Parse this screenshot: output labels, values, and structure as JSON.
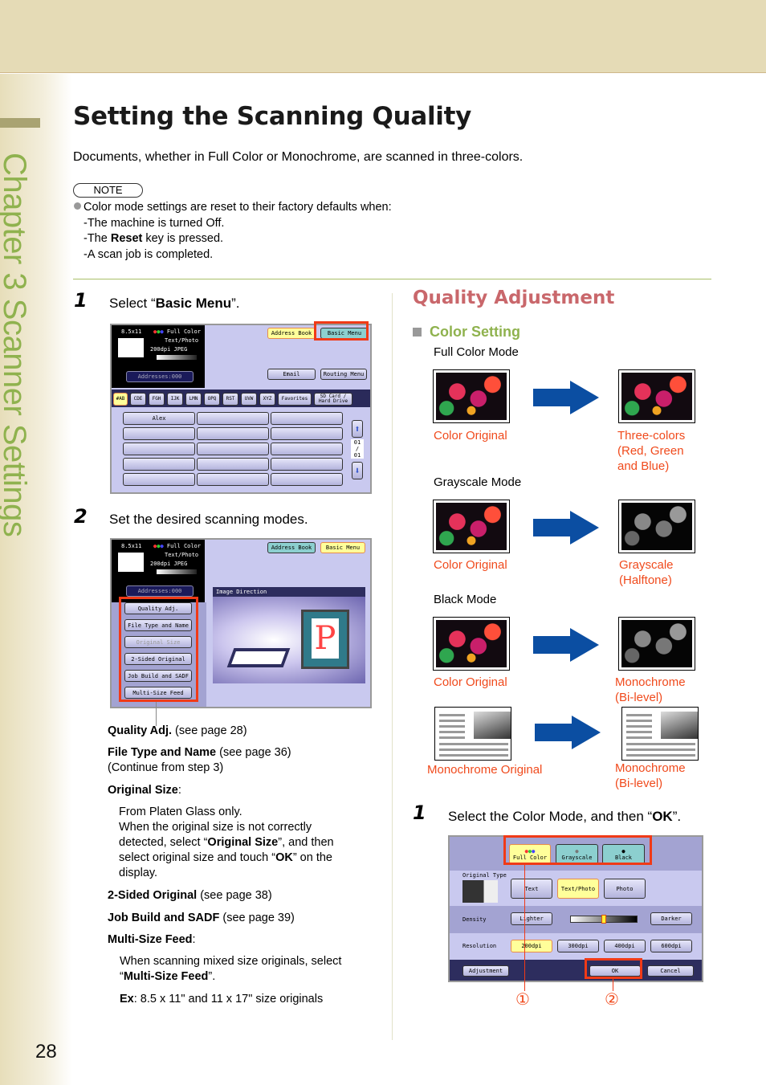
{
  "chapter_label": "Chapter 3   Scanner Settings",
  "page_number": "28",
  "title": "Setting the Scanning Quality",
  "intro": "Documents, whether in Full Color or Monochrome, are scanned in three-colors.",
  "note": {
    "label": "NOTE",
    "lead": "Color mode settings are reset to their factory defaults when:",
    "items": [
      "-The machine is turned Off.",
      "-The ",
      "Reset",
      " key is pressed.",
      "-A scan job is completed."
    ]
  },
  "steps_left": [
    {
      "num": "1",
      "pre": "Select “",
      "bold": "Basic Menu",
      "post": "”."
    },
    {
      "num": "2",
      "text": "Set the desired scanning modes."
    }
  ],
  "screen1": {
    "paper": "8.5x11",
    "color_mode": "Full Color",
    "orig_type": "Text/Photo",
    "res_format": "200dpi JPEG",
    "addresses": "Addresses:000",
    "address_book": "Address Book",
    "basic_menu": "Basic Menu",
    "email": "Email",
    "routing_menu": "Routing Menu",
    "tabs": [
      "#AB",
      "CDE",
      "FGH",
      "IJK",
      "LMN",
      "OPQ",
      "RST",
      "UVW",
      "XYZ",
      "Favorites",
      "SD Card / Hard Drive"
    ],
    "entries": [
      "Alex"
    ],
    "page_indicator": "01 / 01"
  },
  "screen2": {
    "paper": "8.5x11",
    "color_mode": "Full Color",
    "orig_type": "Text/Photo",
    "res_format": "200dpi JPEG",
    "addresses": "Addresses:000",
    "address_book": "Address Book",
    "basic_menu": "Basic Menu",
    "menu": [
      "Quality Adj.",
      "File Type and Name",
      "Original Size",
      "2-Sided Original",
      "Job Build and SADF",
      "Multi-Size Feed"
    ],
    "panel_title": "Image Direction"
  },
  "descriptions": [
    {
      "bold": "Quality Adj.",
      "rest": " (see page 28)"
    },
    {
      "bold": "File Type and Name",
      "rest": " (see page 36)",
      "extra": " (Continue from step 3)"
    },
    {
      "bold": "Original Size",
      "rest": ":"
    },
    {
      "text": "From Platen Glass only."
    },
    {
      "text": "When the original size is not correctly"
    },
    {
      "pre": "detected, select “",
      "bold": "Original Size",
      "post": "”, and then"
    },
    {
      "pre": "select original size and touch “",
      "bold": "OK",
      "post": "” on the"
    },
    {
      "text": "display."
    },
    {
      "bold": "2-Sided Original",
      "rest": " (see page 38)"
    },
    {
      "bold": "Job Build and SADF",
      "rest": " (see page 39)"
    },
    {
      "bold": "Multi-Size Feed",
      "rest": ":"
    },
    {
      "text": "When scanning mixed size originals, select"
    },
    {
      "pre": "“",
      "bold": "Multi-Size Feed",
      "post": "”."
    },
    {
      "bold": "Ex",
      "rest": ": 8.5 x 11\" and 11 x 17\" size originals"
    }
  ],
  "quality": {
    "title": "Quality Adjustment",
    "subtitle": "Color Setting",
    "modes": [
      {
        "label": "Full Color Mode",
        "from": "Color Original",
        "to": [
          "Three-colors",
          "(Red, Green",
          "and Blue)"
        ]
      },
      {
        "label": "Grayscale Mode",
        "from": "Color Original",
        "to": [
          "Grayscale",
          "(Halftone)"
        ]
      },
      {
        "label": "Black Mode",
        "from": "Color Original",
        "to": [
          "Monochrome",
          "(Bi-level)"
        ]
      },
      {
        "label": "",
        "from": "Monochrome Original",
        "to": [
          "Monochrome",
          "(Bi-level)"
        ]
      }
    ]
  },
  "step_right": {
    "num": "1",
    "pre": "Select the Color Mode, and then “",
    "bold": "OK",
    "post": "”."
  },
  "screen3": {
    "color_modes": [
      "Full Color",
      "Grayscale",
      "Black"
    ],
    "original_type_label": "Original Type",
    "original_types": [
      "Text",
      "Text/Photo",
      "Photo"
    ],
    "density_label": "Density",
    "lighter": "Lighter",
    "darker": "Darker",
    "density_level": 0.5,
    "resolution_label": "Resolution",
    "resolutions": [
      "200dpi",
      "300dpi",
      "400dpi",
      "600dpi"
    ],
    "adjustment": "Adjustment",
    "ok": "OK",
    "cancel": "Cancel"
  },
  "callouts": [
    "①",
    "②"
  ],
  "colors": {
    "accent_red": "#f03a17",
    "caption_orange": "#f04a1c",
    "heading_pink": "#c9676b",
    "heading_green": "#8fb24e",
    "arrow_blue": "#0b4ea2"
  }
}
